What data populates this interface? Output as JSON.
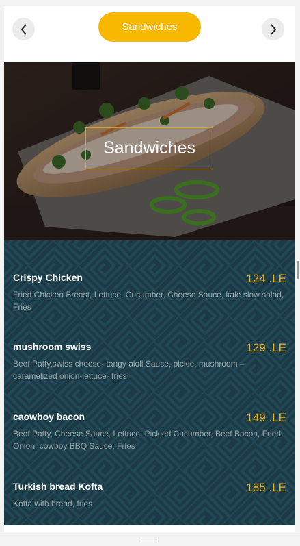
{
  "header": {
    "category_pill": "Sandwiches",
    "prev_icon": "chevron-left-icon",
    "next_icon": "chevron-right-icon"
  },
  "hero": {
    "title": "Sandwiches"
  },
  "menu": {
    "items": [
      {
        "name": "Crispy Chicken",
        "price": "124 .LE",
        "description": "Fried Chicken Breast, Lettuce, Cucumber, Cheese Sauce, kale slow salad, Fries"
      },
      {
        "name": "mushroom swiss",
        "price": "129 .LE",
        "description": "Beef Patty,swiss cheese- tangy aioli Sauce, pickle, mushroom – caramelized onion-lettuce- fries"
      },
      {
        "name": "caowboy bacon",
        "price": "149 .LE",
        "description": "Beef Patty, Cheese Sauce, Lettuce, Pickled Cucumber, Beef Bacon, Fried Onion, cowboy BBQ Sauce, Fries"
      },
      {
        "name": "Turkish bread Kofta",
        "price": "185 .LE",
        "description": "Kofta with bread, fries"
      }
    ]
  },
  "colors": {
    "accent": "#f9b800",
    "price": "#f2b21a",
    "menu_background": "#1b3a46"
  }
}
